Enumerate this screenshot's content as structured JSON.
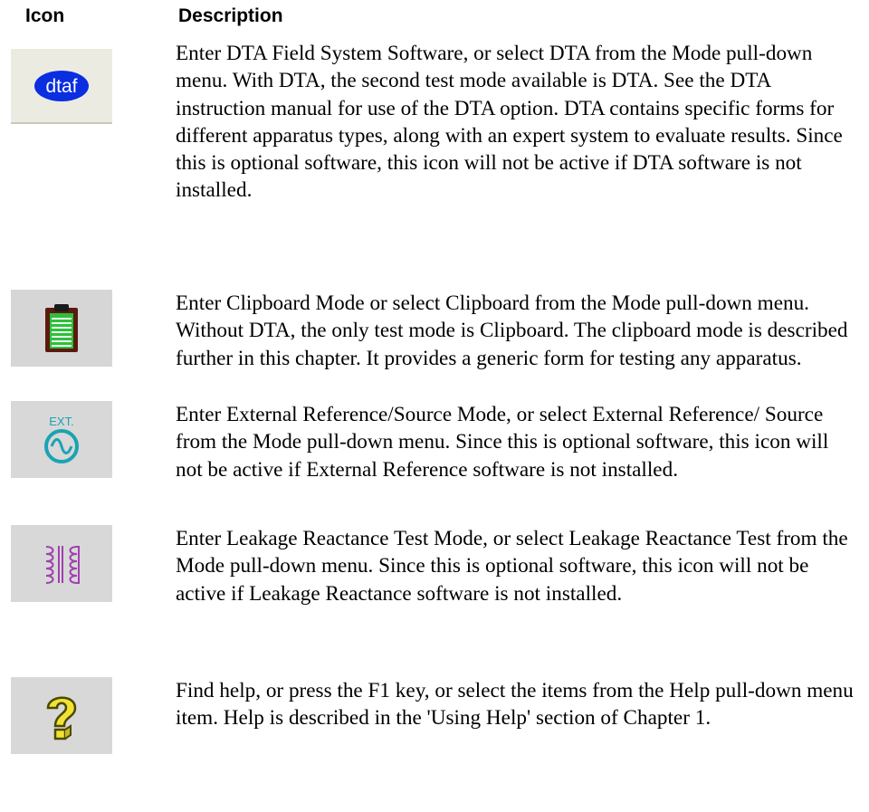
{
  "headers": {
    "icon": "Icon",
    "description": "Description"
  },
  "rows": [
    {
      "icon": "dtaf-icon",
      "icon_text": "dtaf",
      "description": "Enter DTA Field System Software, or select DTA from the Mode pull-down menu. With DTA, the second test mode available is DTA. See the DTA instruction manual for use of the DTA option. DTA contains specific forms for different apparatus types, along with an expert system to evaluate results. Since this is optional software, this icon will not be active if DTA software is not installed."
    },
    {
      "icon": "clipboard-icon",
      "description": "Enter Clipboard Mode or select Clipboard from the Mode pull-down menu. Without DTA, the only test mode is Clipboard. The clipboard mode is described further in this chapter. It provides a generic form for testing any apparatus."
    },
    {
      "icon": "external-source-icon",
      "icon_text": "EXT.",
      "description": "Enter External Reference/Source Mode, or select External Reference/ Source from the Mode pull-down menu. Since this is optional software, this icon will not be active if External Reference software is not installed."
    },
    {
      "icon": "transformer-icon",
      "description": "Enter Leakage Reactance Test Mode, or select Leakage Reactance Test from the Mode pull-down menu. Since this is optional software, this icon will not be active if Leakage Reactance software is not installed."
    },
    {
      "icon": "help-icon",
      "description": "Find help, or press the F1 key, or select the items from the Help pull-down menu item. Help is described in the 'Using Help' section of Chapter 1."
    }
  ],
  "colors": {
    "dtaf_blue": "#0a2ee0",
    "clipboard_frame": "#5a1a10",
    "clipboard_paper": "#2fbf3a",
    "ext_teal": "#1aa3b3",
    "transformer_purple": "#a040b0",
    "help_yellow": "#f2e233"
  }
}
